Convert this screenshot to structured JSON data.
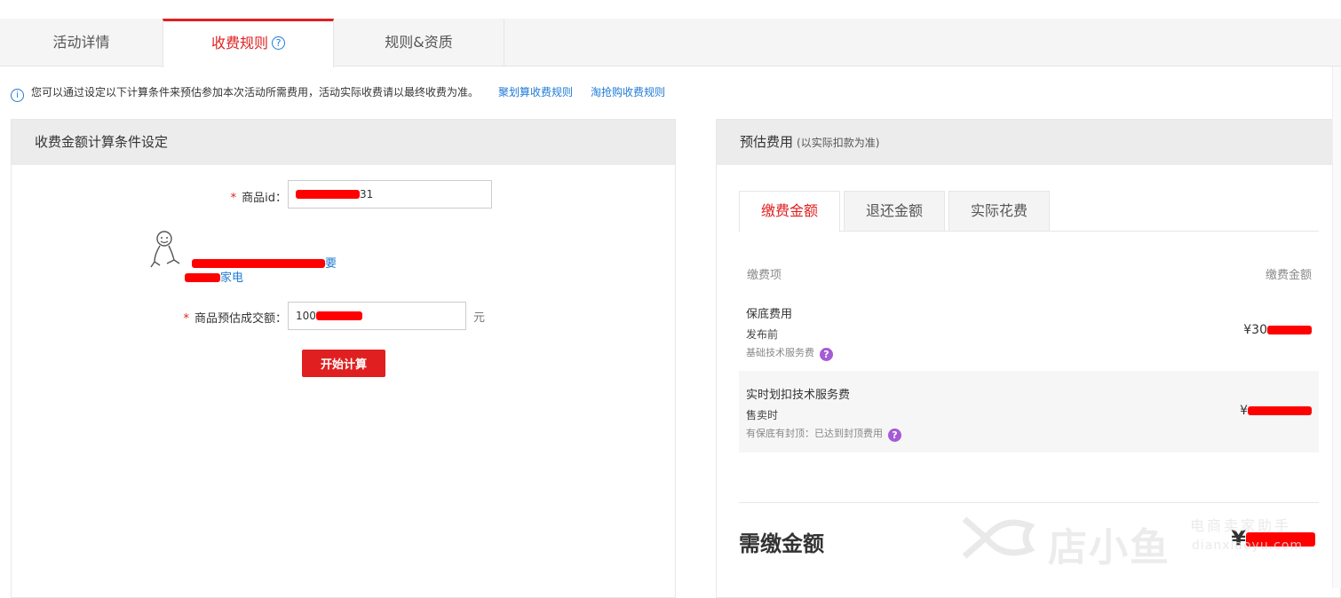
{
  "tabs": [
    {
      "label": "活动详情"
    },
    {
      "label": "收费规则",
      "help": "?"
    },
    {
      "label": "规则&资质"
    }
  ],
  "notice": {
    "icon": "info-icon",
    "text": "您可以通过设定以下计算条件来预估参加本次活动所需费用，活动实际收费请以最终收费为准。",
    "link1": "聚划算收费规则",
    "link2": "淘抢购收费规则"
  },
  "left_panel": {
    "title": "收费金额计算条件设定",
    "product_id": {
      "label": "商品id：",
      "value_suffix": "31"
    },
    "product_link": {
      "line1_end": "要",
      "line2_end": "家电"
    },
    "deal_amount": {
      "label": "商品预估成交额：",
      "value_prefix": "100",
      "unit": "元"
    },
    "calc_button": "开始计算"
  },
  "right_panel": {
    "title": "预估费用",
    "subtitle": "(以实际扣款为准)",
    "tabs": [
      "缴费金额",
      "退还金额",
      "实际花费"
    ],
    "fee_header": {
      "item": "缴费项",
      "amount": "缴费金额"
    },
    "rows": [
      {
        "title": "保底费用",
        "sub": "发布前",
        "note": "基础技术服务费",
        "amount_prefix": "¥30",
        "amount_suffix": ""
      },
      {
        "title": "实时划扣技术服务费",
        "sub": "售卖时",
        "note": "有保底有封顶：已达到封顶费用",
        "amount_prefix": "¥",
        "amount_suffix": ""
      }
    ],
    "total": {
      "label": "需缴金额",
      "amount_prefix": "¥"
    }
  },
  "watermark": {
    "brand": "店小鱼",
    "sub": "电商卖家助手",
    "url": "dianxiaoyu.com"
  },
  "colors": {
    "accent": "#e02020",
    "link": "#1f7ad6",
    "help": "#a55bd6",
    "redaction": "#ff0000"
  }
}
